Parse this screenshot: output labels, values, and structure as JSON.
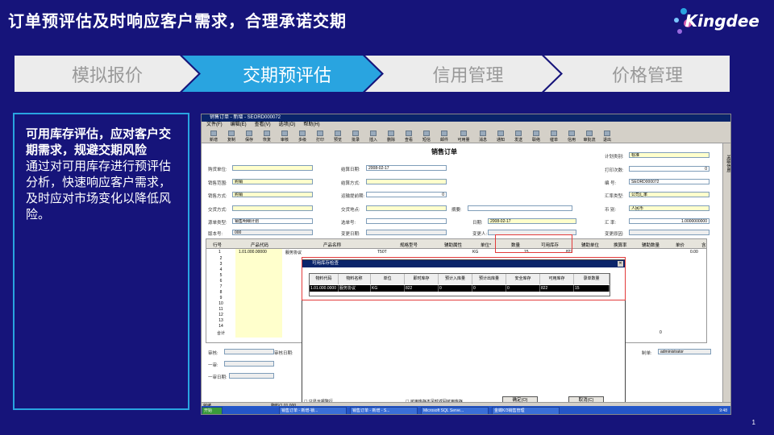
{
  "slide": {
    "title": "订单预评估及时响应客户需求，合理承诺交期",
    "brand": "Kingdee",
    "page_number": "1",
    "colors": {
      "background": "#16147a",
      "active_step": "#29a4e0",
      "inactive_step": "#ececec",
      "highlight": "#e23b3b"
    }
  },
  "steps": [
    {
      "label": "模拟报价",
      "active": false
    },
    {
      "label": "交期预评估",
      "active": true
    },
    {
      "label": "信用管理",
      "active": false
    },
    {
      "label": "价格管理",
      "active": false
    }
  ],
  "panel": {
    "heading": "可用库存评估，应对客户交期需求，规避交期风险",
    "body": "通过对可用库存进行预评估分析，快速响应客户需求，及时应对市场变化以降低风险。"
  },
  "app": {
    "window_title": "销售订单 - 新增 - SEORD000072",
    "menu": [
      "文件(F)",
      "编辑(E)",
      "查看(V)",
      "选项(O)",
      "帮助(H)"
    ],
    "toolbar": [
      "新增",
      "复制",
      "保存",
      "恢复",
      "审核",
      "多级",
      "打印",
      "预览",
      "批录",
      "插入",
      "删除",
      "查看",
      "短信",
      "邮件",
      "可用量",
      "消息",
      "通知",
      "发送",
      "联络",
      "催单",
      "信用",
      "审批流",
      "退出"
    ],
    "form_title": "销售订单",
    "fields": {
      "buyer_label": "购货单位:",
      "date_label": "结算日期:",
      "date_value": "2008-02-17",
      "plan_type_label": "计划类别:",
      "plan_type_value": "标准",
      "sales_range_label": "销售范围:",
      "sales_range_value": "购销",
      "settle_method_label": "结算方式:",
      "print_count_label": "打印次数:",
      "print_count_value": "0",
      "sales_method_label": "销售方式:",
      "sales_method_value": "购销",
      "deliver_days_label": "运输提前期:",
      "deliver_days_value": "0",
      "number_label": "编    号:",
      "number_value": "SEORD000072",
      "deliver_method_label": "交货方式:",
      "deliver_place_label": "交货地点:",
      "summary_label": "摘要:",
      "rate_type_label": "汇率类型:",
      "rate_type_value": "公司汇率",
      "source_type_label": "源单类型:",
      "source_type_value": "销售明细计划",
      "select_label": "选单号:",
      "date2_label": "日期:",
      "date2_value": "2008-02-17",
      "currency_label": "币    别:",
      "currency_value": "人民币",
      "version_label": "版本号:",
      "version_value": "000",
      "change_date_label": "变更日期:",
      "changer_label": "变更人:",
      "rate_label": "汇    率:",
      "rate_value": "1.0000000000",
      "change_reason_label": "变更原因:"
    },
    "grid": {
      "headers": [
        "行号",
        "产品代码",
        "产品名称",
        "规格型号",
        "辅助属性",
        "单位*",
        "数量",
        "可用库存",
        "辅助单位",
        "换算率",
        "辅助数量",
        "单价",
        "含"
      ],
      "row1": {
        "no": "1",
        "code": "1.01.000.00000",
        "name": "服务协议",
        "spec": "T50T",
        "unit": "KG",
        "qty": "15",
        "stock": "822",
        "price": "0.00"
      },
      "row_numbers": [
        "1",
        "2",
        "3",
        "4",
        "5",
        "6",
        "7",
        "8",
        "9",
        "10",
        "11",
        "12",
        "13",
        "14"
      ],
      "total_label": "合计",
      "total_aux": "0"
    },
    "footer_fields": {
      "auditor": "审核:",
      "audit_date": "审核日期:",
      "first": "一审:",
      "first_date": "一审日期:",
      "maker": "制单:",
      "maker_value": "administrator"
    },
    "dialog": {
      "title": "可用库存检查",
      "headers": [
        "物料代码",
        "物料名称",
        "单位",
        "即时库存",
        "预计入库量",
        "预计出库量",
        "安全库存",
        "可用库存",
        "录单数量"
      ],
      "row": [
        "1.01.000.0000",
        "服务协议",
        "KG",
        "822",
        "0",
        "0",
        "0",
        "822",
        "15"
      ],
      "check_label": "只显示报警行",
      "check2_label": "可用库存不足时返回可用库存",
      "ok_label": "确定(O)",
      "cancel_label": "取消(C)"
    },
    "status": {
      "left": "就绪",
      "middle": "物料(1.01.000",
      "right": "销售管理[中间层-物料]"
    },
    "taskbar": [
      "开始",
      "销售订单 - 新增-锁...",
      "销售订单 - 新增 - S...",
      "Microsoft SQL Serve...",
      "金蝶K/3销售管理"
    ],
    "taskbar_time": "9:48",
    "side_label": "关联信息"
  }
}
